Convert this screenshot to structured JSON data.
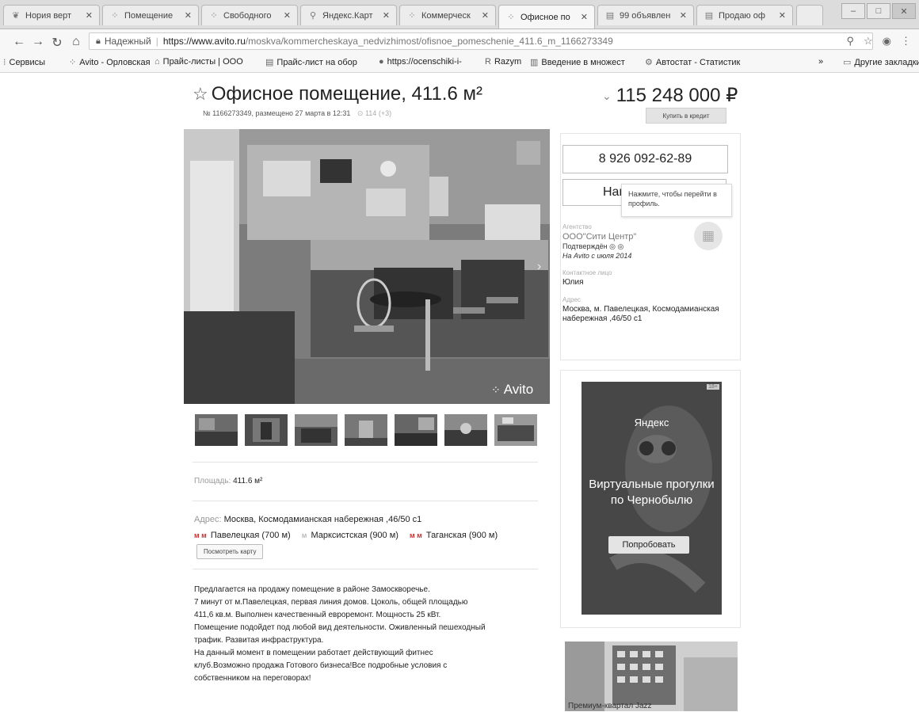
{
  "tabs": [
    {
      "title": "Нория верт",
      "icon": "leaf-icon",
      "active": false
    },
    {
      "title": "Помещение",
      "icon": "avito-icon",
      "active": false
    },
    {
      "title": "Свободного",
      "icon": "avito-icon",
      "active": false
    },
    {
      "title": "Яндекс.Карт",
      "icon": "map-pin-icon",
      "active": false
    },
    {
      "title": "Коммерческ",
      "icon": "avito-icon",
      "active": false
    },
    {
      "title": "Офисное по",
      "icon": "avito-icon",
      "active": true
    },
    {
      "title": "99 объявлен",
      "icon": "doc-icon",
      "active": false
    },
    {
      "title": "Продаю оф",
      "icon": "doc-icon",
      "active": false
    }
  ],
  "address_bar": {
    "secure_label": "Надежный",
    "url_host": "https://www.avito.ru",
    "url_path": "/moskva/kommercheskaya_nedvizhimost/ofisnoe_pomeschenie_411.6_m_1166273349"
  },
  "bookmarks": [
    {
      "label": "Сервисы",
      "icon": "apps-icon"
    },
    {
      "label": "Avito - Орловская",
      "icon": "avito-icon"
    },
    {
      "label": "Прайс-листы | ООО",
      "icon": "house-icon"
    },
    {
      "label": "Прайс-лист на обор",
      "icon": "doc-icon"
    },
    {
      "label": "https://ocenschiki-i-",
      "icon": "circle-icon"
    },
    {
      "label": "Razym",
      "icon": "r-icon"
    },
    {
      "label": "Введение в множест",
      "icon": "book-icon"
    },
    {
      "label": "Автостат - Статистик",
      "icon": "gear-icon"
    }
  ],
  "bookmarks_more": "»",
  "bookmarks_other": "Другие закладки",
  "listing": {
    "title": "Офисное помещение, 411.6 м²",
    "meta": "№ 1166273349, размещено 27 марта в 12:31",
    "views": "114 (+3)",
    "price": "115 248 000 ₽",
    "credit_label": "Купить в кредит",
    "watermark": "Avito",
    "area_label": "Площадь:",
    "area_value": "411.6 м²",
    "address_label": "Адрес:",
    "address_value": "Москва, Космодамианская набережная ,46/50 с1",
    "metro": [
      {
        "name": "Павелецкая (700 м)",
        "color": "#cc3333"
      },
      {
        "name": "Марксистская (900 м)",
        "color": "#bbbbbb"
      },
      {
        "name": "Таганская (900 м)",
        "color": "#cc3333"
      }
    ],
    "map_button": "Посмотреть карту",
    "description": [
      "Предлагается на продажу помещение в районе Замоскворечье.",
      "7 минут от м.Павелецкая, первая линия домов. Цоколь, общей площадью",
      "411,6 кв.м. Выполнен качественный евроремонт. Мощность 25 кВт.",
      "Помещение подойдет под любой вид деятельности. Оживленный пешеходный",
      "трафик. Развитая инфраструктура.",
      "На данный момент в помещении работает действующий фитнес",
      "клуб.Возможно продажа Готового бизнеса!Все подробные условия с",
      "собственником на переговорах!"
    ]
  },
  "seller": {
    "phone": "8 926 092-62-89",
    "write_label": "Напис",
    "tooltip": "Нажмите, чтобы перейти в профиль.",
    "agency_label": "Агентство",
    "agency_name": "ООО\"Сити Центр\"",
    "verified": "Подтверждён",
    "since": "На Avito с июля 2014",
    "contact_label": "Контактное лицо",
    "contact_name": "Юлия",
    "address_label": "Адрес",
    "address_value": "Москва, м. Павелецкая, Космодамианская набережная ,46/50 с1"
  },
  "ad": {
    "brand": "Яндекс",
    "headline": "Виртуальные прогулки по Чернобылю",
    "button": "Попробовать",
    "tag": "18+"
  },
  "ad2": {
    "caption": "Премиум-квартал Jazz"
  }
}
